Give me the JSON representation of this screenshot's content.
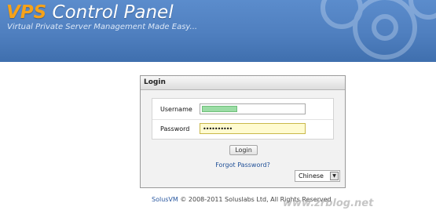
{
  "banner": {
    "brand_vps": "VPS",
    "brand_rest": " Control Panel",
    "tagline": "Virtual Private Server Management Made Easy...",
    "colors": {
      "background": "#4f7fbf",
      "accent": "#f5a21a"
    }
  },
  "login": {
    "header": "Login",
    "username_label": "Username",
    "password_label": "Password",
    "password_mask": "••••••••••",
    "login_button": "Login",
    "forgot_password": "Forgot Password?",
    "language": "Chinese"
  },
  "footer": {
    "brand": "SolusVM",
    "copyright": " © 2008-2011 Soluslabs Ltd, All Rights Reserved"
  },
  "watermark": "www.zrblog.net"
}
